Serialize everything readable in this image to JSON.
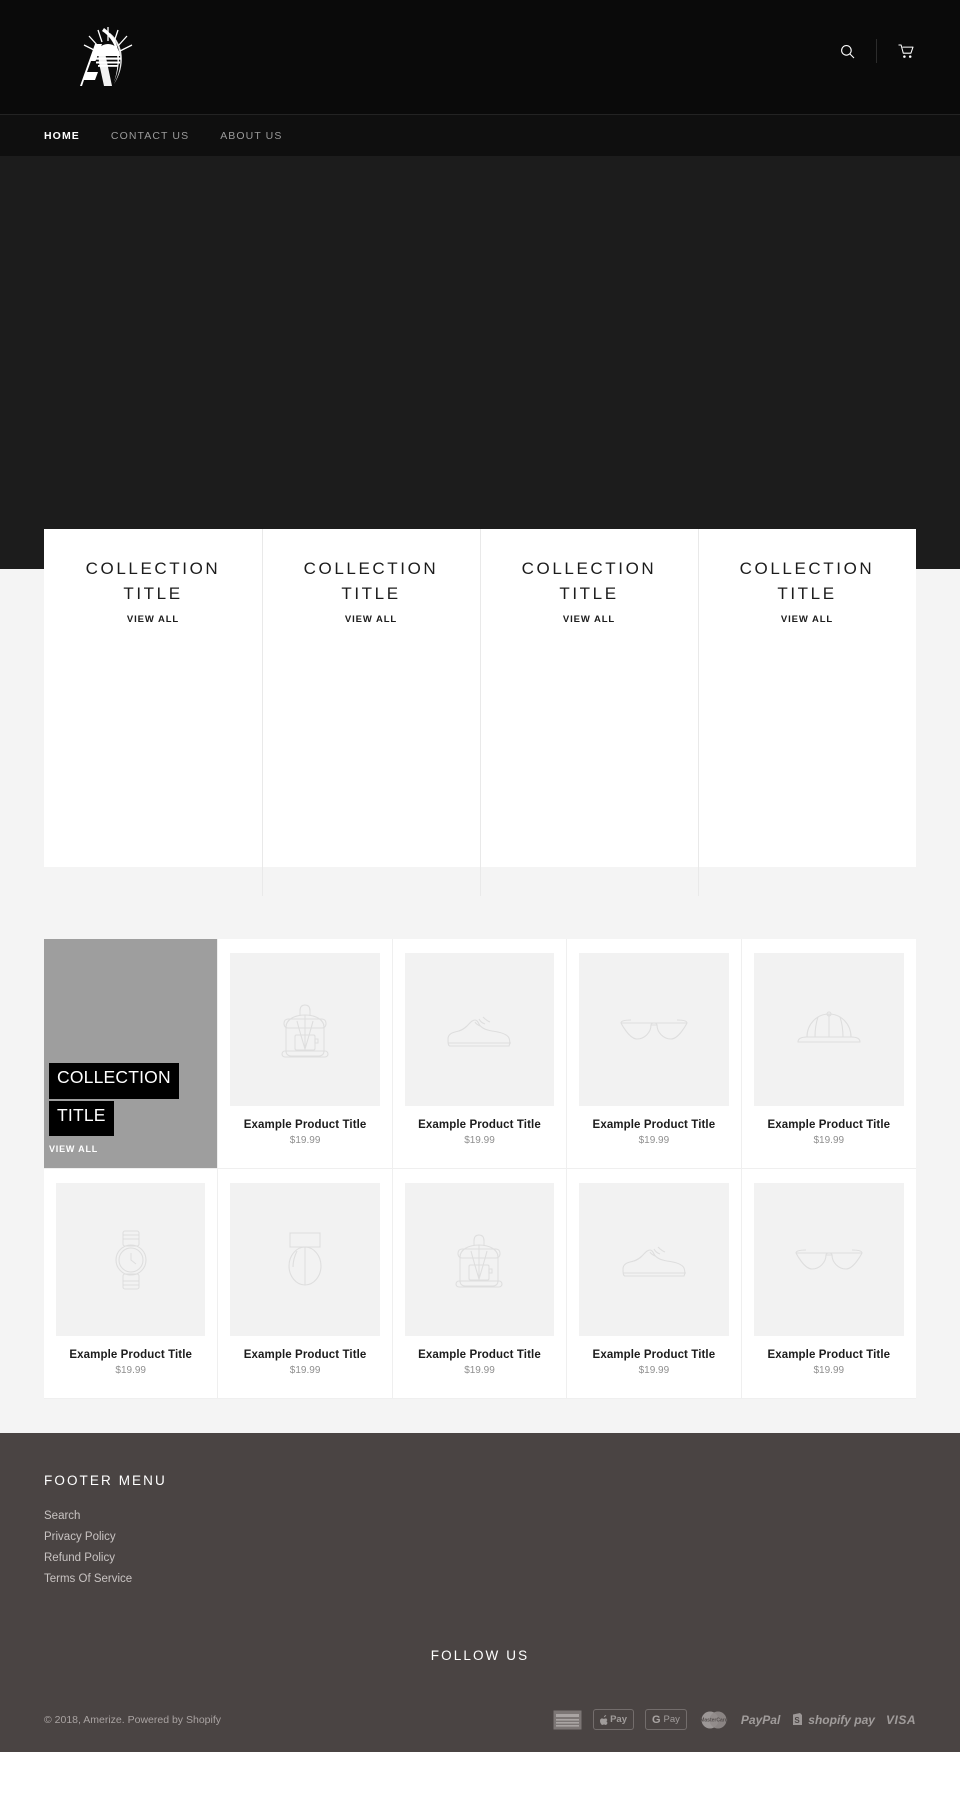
{
  "header": {
    "logo_alt": "Amerize logo",
    "icons": [
      {
        "name": "search-icon",
        "label": "Search"
      },
      {
        "name": "cart-icon",
        "label": "Cart"
      }
    ]
  },
  "nav": {
    "items": [
      {
        "label": "Home",
        "active": true
      },
      {
        "label": "Contact us",
        "active": false
      },
      {
        "label": "About us",
        "active": false
      }
    ]
  },
  "hero": {
    "background_color": "#1c1c1c"
  },
  "collections": {
    "view_all_label": "VIEW ALL",
    "items": [
      {
        "line1": "COLLECTION",
        "line2": "TITLE"
      },
      {
        "line1": "COLLECTION",
        "line2": "TITLE"
      },
      {
        "line1": "COLLECTION",
        "line2": "TITLE"
      },
      {
        "line1": "COLLECTION",
        "line2": "TITLE"
      }
    ]
  },
  "grid": {
    "feature": {
      "line1": "COLLECTION",
      "line2": "TITLE",
      "view_all_label": "VIEW ALL",
      "background_color": "#9e9e9e"
    },
    "products": [
      {
        "icon": "backpack-icon",
        "title": "Example Product Title",
        "price": "$19.99"
      },
      {
        "icon": "sneaker-icon",
        "title": "Example Product Title",
        "price": "$19.99"
      },
      {
        "icon": "glasses-icon",
        "title": "Example Product Title",
        "price": "$19.99"
      },
      {
        "icon": "cap-icon",
        "title": "Example Product Title",
        "price": "$19.99"
      },
      {
        "icon": "watch-icon",
        "title": "Example Product Title",
        "price": "$19.99"
      },
      {
        "icon": "bag-icon",
        "title": "Example Product Title",
        "price": "$19.99"
      },
      {
        "icon": "backpack-icon",
        "title": "Example Product Title",
        "price": "$19.99"
      },
      {
        "icon": "sneaker-icon",
        "title": "Example Product Title",
        "price": "$19.99"
      },
      {
        "icon": "glasses-icon",
        "title": "Example Product Title",
        "price": "$19.99"
      }
    ]
  },
  "footer": {
    "menu_heading": "FOOTER MENU",
    "links": [
      "Search",
      "Privacy Policy",
      "Refund Policy",
      "Terms Of Service"
    ],
    "follow_heading": "FOLLOW US",
    "copyright": "© 2018, Amerize. Powered by Shopify",
    "payments": [
      {
        "name": "amex-icon",
        "label": "AMEX"
      },
      {
        "name": "apple-pay-icon",
        "label": "Pay"
      },
      {
        "name": "google-pay-icon",
        "label": "Pay"
      },
      {
        "name": "mastercard-icon",
        "label": "MasterCard"
      },
      {
        "name": "paypal-icon",
        "label": "PayPal"
      },
      {
        "name": "shopify-pay-icon",
        "label": "shopify pay"
      },
      {
        "name": "visa-icon",
        "label": "VISA"
      }
    ]
  },
  "colors": {
    "header_bg": "#0a0a0a",
    "nav_bg": "#0f0f0f",
    "hero_bg": "#1c1c1c",
    "page_bg": "#f4f4f4",
    "footer_bg": "#4a4443",
    "feature_gray": "#9e9e9e"
  }
}
